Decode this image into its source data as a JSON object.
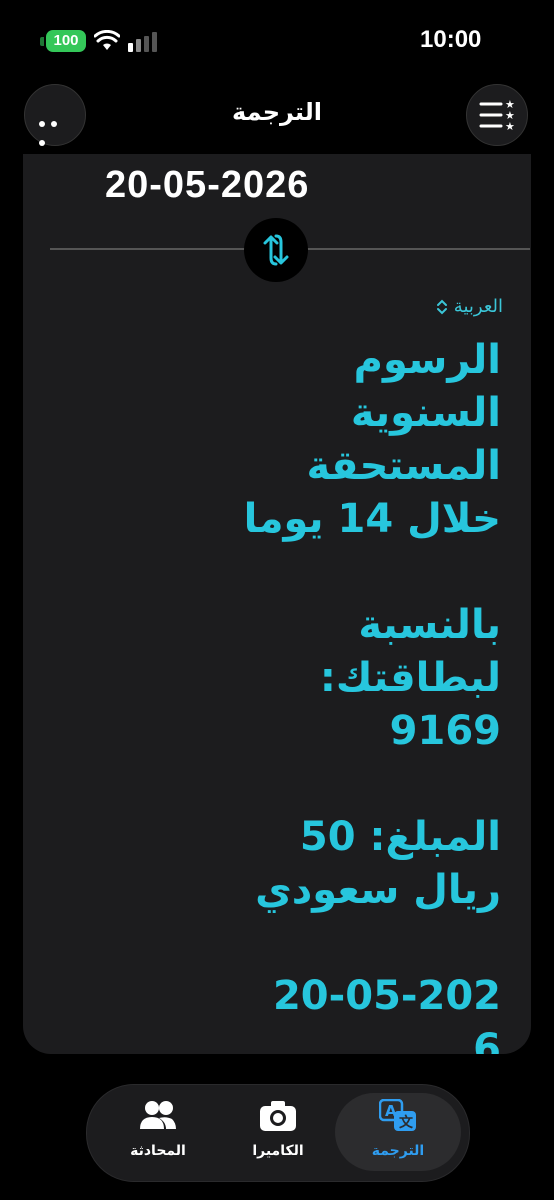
{
  "status_bar": {
    "time": "10:00",
    "battery": "100"
  },
  "header": {
    "title": "الترجمة"
  },
  "translation": {
    "source_text": "20-05-2026",
    "target_language": "العربية",
    "result_text": "الرسوم\nالسنوية\nالمستحقة\nخلال 14 يوما\n\nبالنسبة\nلبطاقتك:\n9169\n\nالمبلغ: 50\nريال سعودي\n\n20-05-202\n6"
  },
  "tabs": [
    {
      "label": "المحادثة",
      "icon": "people-icon"
    },
    {
      "label": "الكاميرا",
      "icon": "camera-icon"
    },
    {
      "label": "الترجمة",
      "icon": "translate-icon",
      "active": true
    }
  ],
  "colors": {
    "accent": "#27c6dd",
    "tab_active": "#2f9df0",
    "battery": "#34c759"
  }
}
